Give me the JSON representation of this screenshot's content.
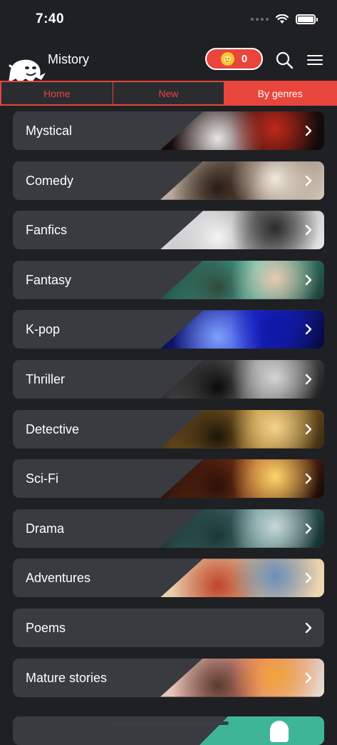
{
  "status_bar": {
    "time": "7:40"
  },
  "header": {
    "app_title": "Mistory",
    "coins": "0"
  },
  "tabs": [
    {
      "label": "Home",
      "active": false
    },
    {
      "label": "New",
      "active": false
    },
    {
      "label": "By genres",
      "active": true
    }
  ],
  "genres": [
    {
      "label": "Mystical",
      "art": [
        "#0a0a0a",
        "#3a1010",
        "#c02a1a",
        "#e8e8e8"
      ]
    },
    {
      "label": "Comedy",
      "art": [
        "#d9cdbd",
        "#5a4535",
        "#f2e8dc",
        "#2a1c16"
      ]
    },
    {
      "label": "Fanfics",
      "art": [
        "#e9e9e9",
        "#8c8c8c",
        "#2a2a2a",
        "#f5f5f5"
      ]
    },
    {
      "label": "Fantasy",
      "art": [
        "#1c3a30",
        "#4ac9b8",
        "#e8c9b0",
        "#304a3a"
      ]
    },
    {
      "label": "K-pop",
      "art": [
        "#06083a",
        "#1f2bd9",
        "#0e17a8",
        "#7fa0ff"
      ]
    },
    {
      "label": "Thriller",
      "art": [
        "#1a1a1a",
        "#8a8a8a",
        "#d4d4d4",
        "#0a0a0a"
      ]
    },
    {
      "label": "Detective",
      "art": [
        "#3a2810",
        "#b8862e",
        "#f3d48a",
        "#1d140a"
      ]
    },
    {
      "label": "Sci-Fi",
      "art": [
        "#120805",
        "#a8461c",
        "#ffd66b",
        "#2a1008"
      ]
    },
    {
      "label": "Drama",
      "art": [
        "#0f2a2a",
        "#5a8a8a",
        "#c8d8d8",
        "#1c3636"
      ]
    },
    {
      "label": "Adventures",
      "art": [
        "#f0d9b8",
        "#d9b48a",
        "#6a8fb8",
        "#c0452a"
      ]
    },
    {
      "label": "Poems",
      "art": []
    },
    {
      "label": "Mature stories",
      "art": [
        "#e8e0d2",
        "#e07a72",
        "#f2a33a",
        "#5a3a30"
      ]
    }
  ]
}
